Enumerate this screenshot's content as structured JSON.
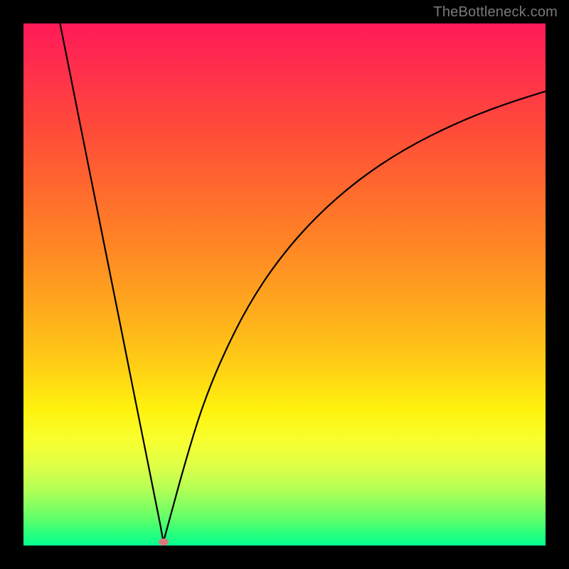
{
  "watermark": "TheBottleneck.com",
  "dot": {
    "x_norm": 0.268,
    "y_norm": 0.993
  },
  "curve_color": "#000000",
  "dot_color": "#d97a7a",
  "chart_data": {
    "type": "line",
    "title": "",
    "xlabel": "",
    "ylabel": "",
    "xlim": [
      0,
      1
    ],
    "ylim": [
      0,
      1
    ],
    "note": "Axes are normalized 0–1; no numeric tick labels are shown in the source image. y_norm is measured from the top (0 = top edge, 1 = bottom edge).",
    "series": [
      {
        "name": "left-branch",
        "x": [
          0.07,
          0.09,
          0.11,
          0.13,
          0.15,
          0.17,
          0.19,
          0.21,
          0.23,
          0.25,
          0.262,
          0.268
        ],
        "y_norm": [
          0.0,
          0.1,
          0.2,
          0.3,
          0.4,
          0.5,
          0.6,
          0.7,
          0.8,
          0.9,
          0.96,
          0.993
        ]
      },
      {
        "name": "right-branch",
        "x": [
          0.268,
          0.285,
          0.31,
          0.34,
          0.38,
          0.43,
          0.49,
          0.56,
          0.64,
          0.73,
          0.83,
          0.92,
          1.0
        ],
        "y_norm": [
          0.993,
          0.93,
          0.84,
          0.74,
          0.64,
          0.54,
          0.45,
          0.37,
          0.3,
          0.24,
          0.19,
          0.155,
          0.13
        ]
      }
    ]
  }
}
